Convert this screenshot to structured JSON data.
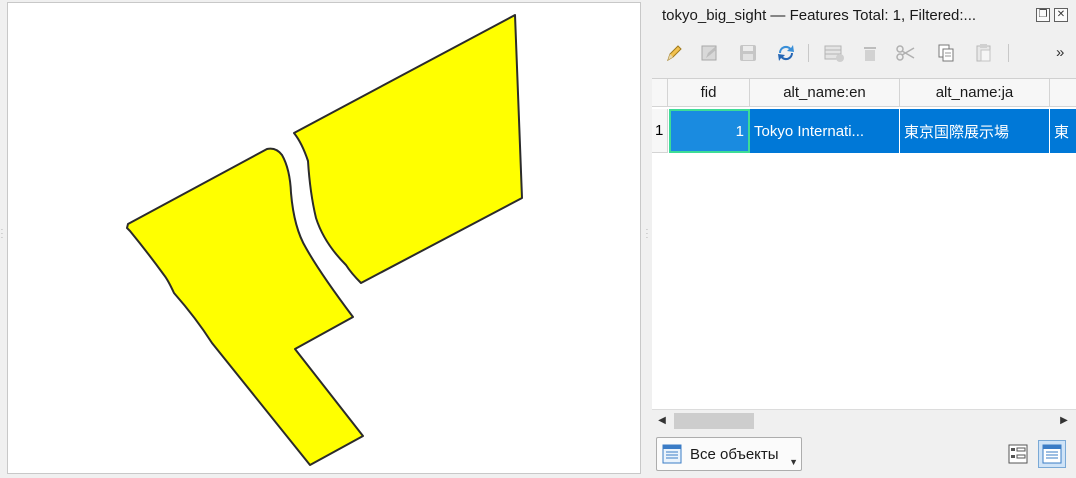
{
  "dock": {
    "title": "tokyo_big_sight — Features Total: 1, Filtered:..."
  },
  "toolbar": {
    "icons": [
      "pencil-icon",
      "multi-edit-icon",
      "save-icon",
      "reload-icon",
      "add-feature-icon",
      "delete-icon",
      "cut-icon",
      "copy-icon",
      "paste-icon"
    ],
    "more": "»"
  },
  "table": {
    "columns": [
      "fid",
      "alt_name:en",
      "alt_name:ja",
      ""
    ],
    "rows": [
      {
        "header": "1",
        "cells": [
          "1",
          "Tokyo Internati...",
          "東京国際展示場",
          "東"
        ]
      }
    ]
  },
  "footer": {
    "filter_label": "Все объекты"
  },
  "colors": {
    "feature_fill": "#ffff00",
    "feature_stroke": "#2b2b2b",
    "selection": "#0078d7",
    "current_cell_border": "#3ddc97"
  }
}
